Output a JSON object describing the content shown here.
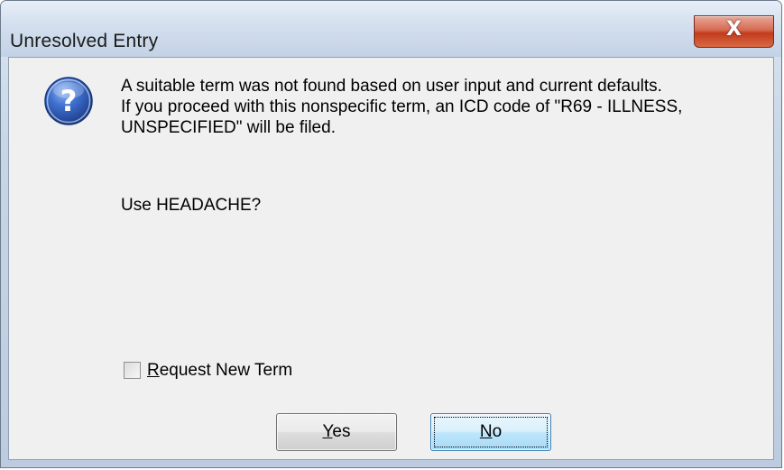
{
  "window": {
    "title": "Unresolved Entry",
    "close_label": "X"
  },
  "dialog": {
    "icon": "question-icon",
    "message_lines": [
      "A suitable term was not found based on user input and current defaults.",
      "If you proceed with this nonspecific term, an ICD code of \"R69 - ILLNESS,",
      "UNSPECIFIED\" will be filed."
    ],
    "prompt": "Use  HEADACHE?",
    "checkbox": {
      "label": "Request New Term",
      "checked": false
    },
    "buttons": {
      "yes_label": "Yes",
      "no_label": "No",
      "default": "No"
    }
  },
  "colors": {
    "titlebar": "#d3dfee",
    "client_background": "#f0f0f0",
    "close_button": "#c23b1c",
    "icon_blue": "#2f5fb8"
  }
}
